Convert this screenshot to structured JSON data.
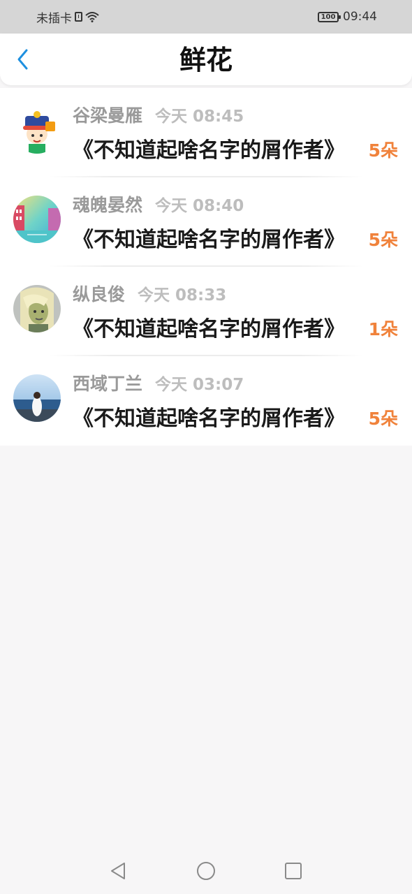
{
  "status_bar": {
    "carrier": "未插卡",
    "battery": "100",
    "time": "09:44"
  },
  "header": {
    "title": "鲜花",
    "back_icon": "chevron-left-icon"
  },
  "colors": {
    "accent_back": "#1e90e0",
    "count": "#f0823b",
    "name": "#9a9a9a",
    "time": "#bdbdbd"
  },
  "items": [
    {
      "name": "谷梁曼雁",
      "time": "今天 08:45",
      "work": "《不知道起啥名字的屑作者》",
      "count": "5朵"
    },
    {
      "name": "魂魄晏然",
      "time": "今天 08:40",
      "work": "《不知道起啥名字的屑作者》",
      "count": "5朵"
    },
    {
      "name": "纵良俊",
      "time": "今天 08:33",
      "work": "《不知道起啥名字的屑作者》",
      "count": "1朵"
    },
    {
      "name": "西域丁兰",
      "time": "今天 03:07",
      "work": "《不知道起啥名字的屑作者》",
      "count": "5朵"
    }
  ],
  "nav": {
    "back_icon": "triangle-back-icon",
    "home_icon": "circle-home-icon",
    "recents_icon": "square-recents-icon"
  }
}
